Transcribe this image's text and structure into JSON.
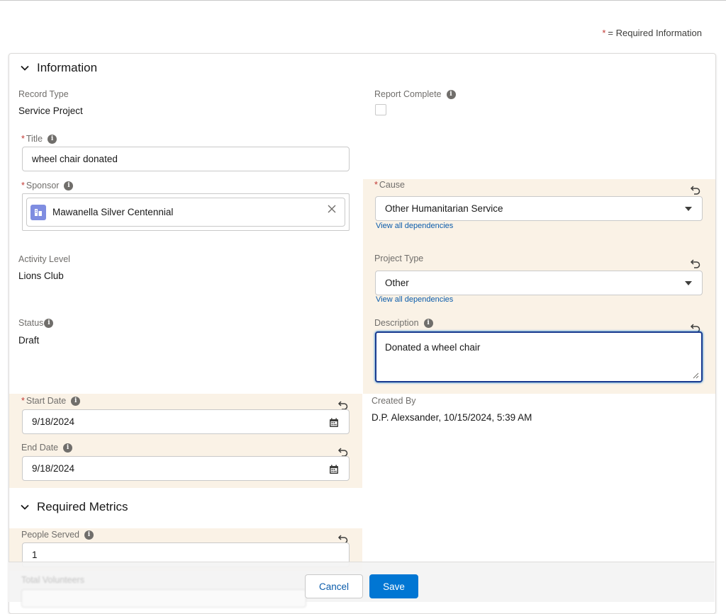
{
  "required_note": {
    "star": "*",
    "text": "= Required Information"
  },
  "sections": {
    "information": "Information",
    "required_metrics": "Required Metrics"
  },
  "fields": {
    "record_type": {
      "label": "Record Type",
      "value": "Service Project"
    },
    "report_complete": {
      "label": "Report Complete",
      "checked": false
    },
    "title": {
      "label": "Title",
      "value": "wheel chair donated"
    },
    "sponsor": {
      "label": "Sponsor",
      "value": "Mawanella Silver Centennial"
    },
    "cause": {
      "label": "Cause",
      "value": "Other Humanitarian Service",
      "link": "View all dependencies"
    },
    "activity_level": {
      "label": "Activity Level",
      "value": "Lions Club"
    },
    "project_type": {
      "label": "Project Type",
      "value": "Other",
      "link": "View all dependencies"
    },
    "status": {
      "label": "Status",
      "value": "Draft"
    },
    "description": {
      "label": "Description",
      "value": "Donated a wheel chair"
    },
    "start_date": {
      "label": "Start Date",
      "value": "9/18/2024"
    },
    "created_by": {
      "label": "Created By",
      "value": "D.P. Alexsander, 10/15/2024, 5:39 AM"
    },
    "end_date": {
      "label": "End Date",
      "value": "9/18/2024"
    },
    "people_served": {
      "label": "People Served",
      "value": "1"
    },
    "total_volunteers": {
      "label": "Total Volunteers"
    }
  },
  "buttons": {
    "cancel": "Cancel",
    "save": "Save"
  },
  "colors": {
    "highlight": "#faf2e6",
    "brand": "#0176d3",
    "required": "#c23934",
    "link": "#0b5cab"
  },
  "icons": [
    "chevron-down-icon",
    "info-icon",
    "undo-icon",
    "close-icon",
    "calendar-icon",
    "dropdown-caret-icon",
    "account-icon"
  ]
}
